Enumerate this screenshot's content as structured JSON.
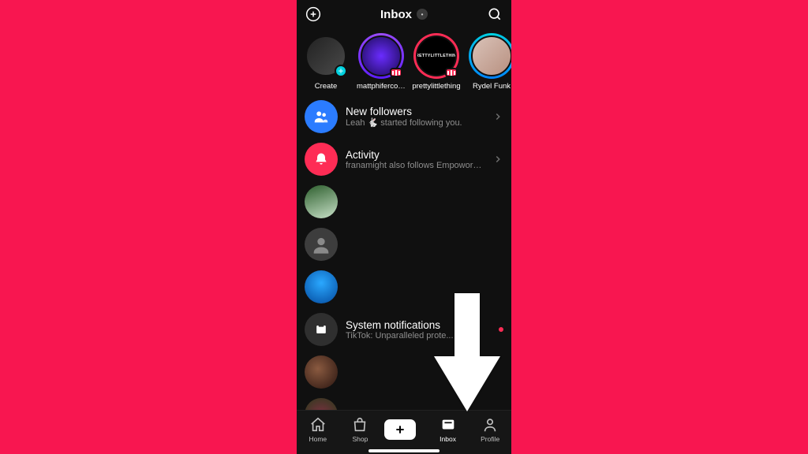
{
  "header": {
    "title": "Inbox"
  },
  "stories": [
    {
      "label": "Create",
      "showPlus": true,
      "ringColor": "",
      "bg": "linear-gradient(135deg,#2a2a2a,#5a5a5a)"
    },
    {
      "label": "mattphifercoa...",
      "showLive": true,
      "ringColor": "#9c4dff",
      "bg": "radial-gradient(circle at 50% 50%, #6a2cff, #1b0a55)"
    },
    {
      "label": "prettylittlething",
      "showLive": true,
      "ringColor": "#fe2c55",
      "bg": "#000",
      "text": "PRETTYLITTLETHING"
    },
    {
      "label": "Rydel Funk",
      "showLive": false,
      "ringColor": "#00d2e0",
      "bg": "linear-gradient(135deg,#caa,#e8d8d0)"
    }
  ],
  "items": [
    {
      "type": "notif",
      "icon": "followers",
      "title": "New followers",
      "sub": "Leah 🐇 started following you.",
      "chev": true
    },
    {
      "type": "notif",
      "icon": "activity",
      "title": "Activity",
      "sub": "franamight also follows Empoword J...",
      "chev": true
    },
    {
      "type": "chat",
      "bg": "linear-gradient(160deg,#2d5e2d,#c7e0c7)",
      "title": "",
      "sub": ""
    },
    {
      "type": "chat",
      "bg": "radial-gradient(circle at 50% 42%, #bbb, #888)",
      "placeholder": true,
      "title": "",
      "sub": ""
    },
    {
      "type": "chat",
      "bg": "radial-gradient(circle at 50% 40%, #2aa8ff, #044a9e)",
      "title": "",
      "sub": ""
    },
    {
      "type": "notif",
      "icon": "system",
      "title": "System notifications",
      "sub": "TikTok: Unparalleled prote... · 4d",
      "chev": false,
      "unread": true
    },
    {
      "type": "chat",
      "bg": "radial-gradient(circle at 40% 40%, #704030, #2a1510)",
      "title": "",
      "sub": ""
    },
    {
      "type": "chat",
      "bg": "radial-gradient(circle at 50% 50%, #7a3040, #2a3a1a)",
      "title": "",
      "sub": ""
    }
  ],
  "tabs": {
    "home": "Home",
    "shop": "Shop",
    "inbox": "Inbox",
    "profile": "Profile"
  }
}
